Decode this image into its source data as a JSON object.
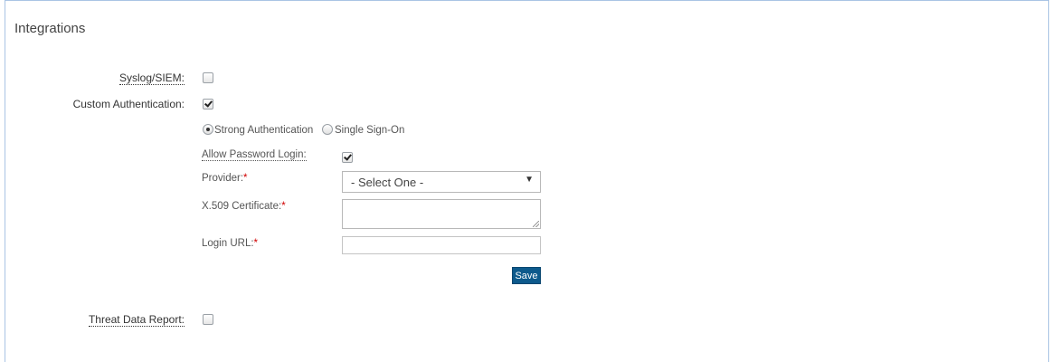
{
  "panel": {
    "title": "Integrations"
  },
  "fields": {
    "syslog": {
      "label": "Syslog/SIEM:",
      "checked": false
    },
    "custom_auth": {
      "label": "Custom Authentication:",
      "checked": true
    },
    "auth_mode": {
      "options": [
        "Strong Authentication",
        "Single Sign-On"
      ],
      "selected": "Strong Authentication"
    },
    "allow_password": {
      "label": "Allow Password Login:",
      "checked": true
    },
    "provider": {
      "label": "Provider:",
      "required_mark": "*",
      "value": "- Select One -"
    },
    "certificate": {
      "label": "X.509 Certificate:",
      "required_mark": "*",
      "value": ""
    },
    "login_url": {
      "label": "Login URL:",
      "required_mark": "*",
      "value": ""
    },
    "threat_report": {
      "label": "Threat Data Report:",
      "checked": false
    }
  },
  "actions": {
    "save_label": "Save"
  },
  "colors": {
    "button_bg": "#0d5a8c",
    "required": "#d00000",
    "panel_border": "#a9c4e4"
  },
  "icons": {
    "select_arrow": "chevron-down-icon",
    "resize": "resize-grip-icon"
  }
}
